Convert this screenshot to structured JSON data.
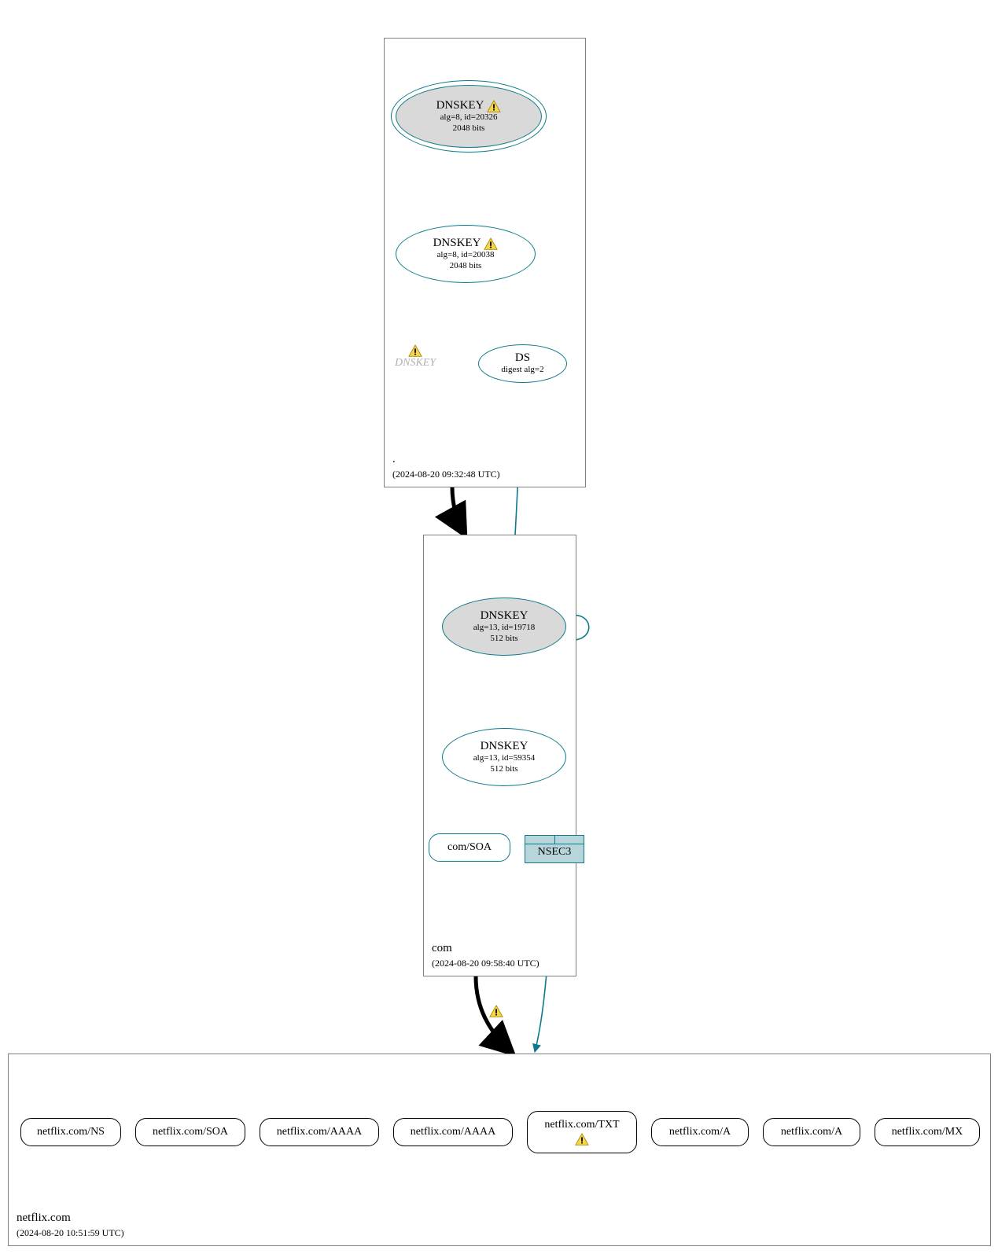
{
  "zones": {
    "root": {
      "name": ".",
      "timestamp": "(2024-08-20 09:32:48 UTC)"
    },
    "com": {
      "name": "com",
      "timestamp": "(2024-08-20 09:58:40 UTC)"
    },
    "leaf": {
      "name": "netflix.com",
      "timestamp": "(2024-08-20 10:51:59 UTC)"
    }
  },
  "nodes": {
    "root_ksk": {
      "title": "DNSKEY",
      "line1": "alg=8, id=20326",
      "line2": "2048 bits",
      "warn": true
    },
    "root_zsk": {
      "title": "DNSKEY",
      "line1": "alg=8, id=20038",
      "line2": "2048 bits",
      "warn": true
    },
    "root_ds": {
      "title": "DS",
      "line1": "digest alg=2"
    },
    "ghost": {
      "label": "DNSKEY"
    },
    "com_ksk": {
      "title": "DNSKEY",
      "line1": "alg=13, id=19718",
      "line2": "512 bits"
    },
    "com_zsk": {
      "title": "DNSKEY",
      "line1": "alg=13, id=59354",
      "line2": "512 bits"
    },
    "com_soa": {
      "title": "com/SOA"
    },
    "nsec3": {
      "title": "NSEC3"
    }
  },
  "records": {
    "r0": "netflix.com/NS",
    "r1": "netflix.com/SOA",
    "r2": "netflix.com/AAAA",
    "r3": "netflix.com/AAAA",
    "r4": "netflix.com/TXT",
    "r5": "netflix.com/A",
    "r6": "netflix.com/A",
    "r7": "netflix.com/MX"
  },
  "chart_data": {
    "type": "graph",
    "description": "DNSSEC delegation / authentication graph",
    "zones": [
      {
        "id": "root",
        "name": ".",
        "analyzed": "2024-08-20 09:32:48 UTC"
      },
      {
        "id": "com",
        "name": "com",
        "analyzed": "2024-08-20 09:58:40 UTC"
      },
      {
        "id": "netflix.com",
        "name": "netflix.com",
        "analyzed": "2024-08-20 10:51:59 UTC"
      }
    ],
    "nodes": [
      {
        "id": "root_ksk",
        "zone": "root",
        "type": "DNSKEY",
        "alg": 8,
        "key_id": 20326,
        "bits": 2048,
        "ksk": true,
        "trust_anchor": true,
        "status": "warning"
      },
      {
        "id": "root_zsk",
        "zone": "root",
        "type": "DNSKEY",
        "alg": 8,
        "key_id": 20038,
        "bits": 2048,
        "status": "warning"
      },
      {
        "id": "root_ghost_key",
        "zone": "root",
        "type": "DNSKEY",
        "present": false,
        "status": "warning"
      },
      {
        "id": "com_ds",
        "zone": "root",
        "type": "DS",
        "digest_alg": 2
      },
      {
        "id": "com_ksk",
        "zone": "com",
        "type": "DNSKEY",
        "alg": 13,
        "key_id": 19718,
        "bits": 512,
        "ksk": true
      },
      {
        "id": "com_zsk",
        "zone": "com",
        "type": "DNSKEY",
        "alg": 13,
        "key_id": 59354,
        "bits": 512
      },
      {
        "id": "com_soa",
        "zone": "com",
        "type": "RRset",
        "name": "com/SOA"
      },
      {
        "id": "com_nsec3",
        "zone": "com",
        "type": "NSEC3"
      },
      {
        "id": "nf_ns",
        "zone": "netflix.com",
        "type": "RRset",
        "name": "netflix.com/NS"
      },
      {
        "id": "nf_soa",
        "zone": "netflix.com",
        "type": "RRset",
        "name": "netflix.com/SOA"
      },
      {
        "id": "nf_aaaa_1",
        "zone": "netflix.com",
        "type": "RRset",
        "name": "netflix.com/AAAA"
      },
      {
        "id": "nf_aaaa_2",
        "zone": "netflix.com",
        "type": "RRset",
        "name": "netflix.com/AAAA"
      },
      {
        "id": "nf_txt",
        "zone": "netflix.com",
        "type": "RRset",
        "name": "netflix.com/TXT",
        "status": "warning"
      },
      {
        "id": "nf_a_1",
        "zone": "netflix.com",
        "type": "RRset",
        "name": "netflix.com/A"
      },
      {
        "id": "nf_a_2",
        "zone": "netflix.com",
        "type": "RRset",
        "name": "netflix.com/A"
      },
      {
        "id": "nf_mx",
        "zone": "netflix.com",
        "type": "RRset",
        "name": "netflix.com/MX"
      }
    ],
    "edges": [
      {
        "from": "root_ksk",
        "to": "root_ksk",
        "kind": "self-sign",
        "color": "teal"
      },
      {
        "from": "root_ksk",
        "to": "root_zsk",
        "kind": "signs",
        "color": "teal"
      },
      {
        "from": "root_zsk",
        "to": "com_ds",
        "kind": "signs",
        "color": "teal"
      },
      {
        "from": "com_ds",
        "to": "com_ksk",
        "kind": "digest-of",
        "color": "teal"
      },
      {
        "from": "root",
        "to": "com",
        "kind": "delegation",
        "color": "black",
        "weight": "heavy"
      },
      {
        "from": "com_ksk",
        "to": "com_ksk",
        "kind": "self-sign",
        "color": "teal"
      },
      {
        "from": "com_ksk",
        "to": "com_zsk",
        "kind": "signs",
        "color": "teal"
      },
      {
        "from": "com_zsk",
        "to": "com_soa",
        "kind": "signs",
        "color": "teal"
      },
      {
        "from": "com_zsk",
        "to": "com_nsec3",
        "kind": "signs",
        "color": "teal"
      },
      {
        "from": "com_nsec3",
        "to": "netflix.com",
        "kind": "nsec-proof",
        "color": "teal"
      },
      {
        "from": "com",
        "to": "netflix.com",
        "kind": "delegation",
        "color": "black",
        "weight": "heavy",
        "status": "warning"
      }
    ]
  }
}
